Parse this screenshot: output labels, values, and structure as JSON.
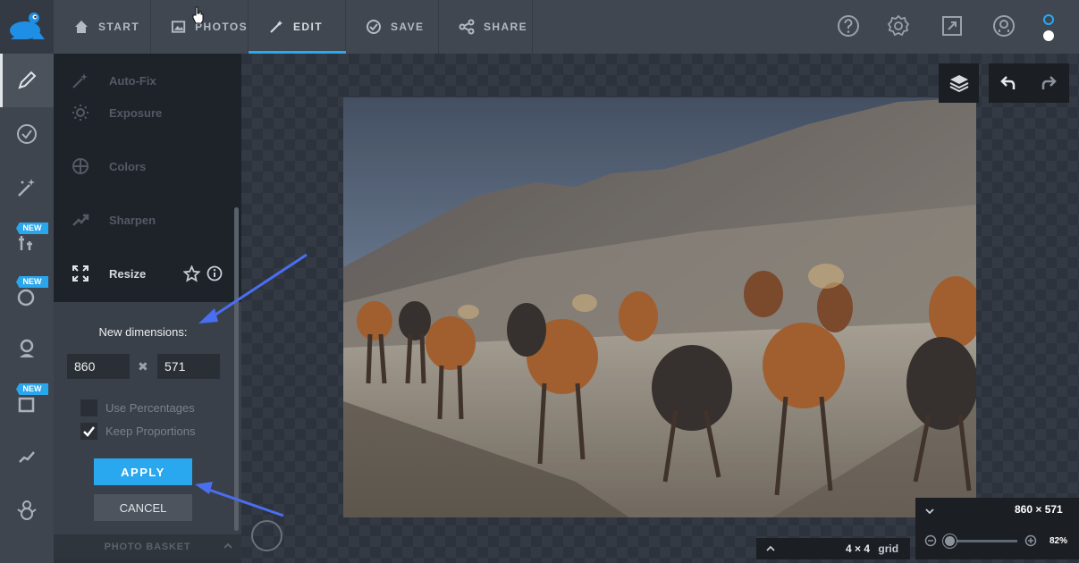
{
  "topbar": {
    "tabs": [
      {
        "label": "START",
        "icon": "home-icon"
      },
      {
        "label": "PHOTOS",
        "icon": "image-icon"
      },
      {
        "label": "EDIT",
        "icon": "magic-wand-icon"
      },
      {
        "label": "SAVE",
        "icon": "check-circle-icon"
      },
      {
        "label": "SHARE",
        "icon": "share-icon"
      }
    ],
    "active_tab": "EDIT",
    "right_icons": [
      "help-icon",
      "settings-badge-icon",
      "fullscreen-icon",
      "account-icon"
    ]
  },
  "sidebar": {
    "items": [
      {
        "icon": "pencil-icon",
        "active": true
      },
      {
        "icon": "gear-badge-icon"
      },
      {
        "icon": "magic-wand-icon"
      },
      {
        "icon": "brush-tools-icon",
        "badge": "NEW"
      },
      {
        "icon": "circle-shape-icon",
        "badge": "NEW"
      },
      {
        "icon": "person-icon"
      },
      {
        "icon": "frame-icon",
        "badge": "NEW"
      },
      {
        "icon": "trend-line-icon"
      },
      {
        "icon": "snowman-icon"
      }
    ]
  },
  "edit_panel": {
    "tools": [
      {
        "label": "Auto-Fix",
        "icon": "magic-wand-icon"
      },
      {
        "label": "Exposure",
        "icon": "sun-icon"
      },
      {
        "label": "Colors",
        "icon": "target-icon"
      },
      {
        "label": "Sharpen",
        "icon": "trend-up-icon"
      },
      {
        "label": "Resize",
        "icon": "resize-icon",
        "active": true
      }
    ],
    "resize": {
      "label": "New dimensions:",
      "width": "860",
      "height": "571",
      "times_symbol": "✖",
      "use_percentages": {
        "label": "Use Percentages",
        "checked": false
      },
      "keep_proportions": {
        "label": "Keep Proportions",
        "checked": true
      },
      "apply_label": "APPLY",
      "cancel_label": "CANCEL"
    },
    "photo_basket_label": "PHOTO BASKET"
  },
  "canvas": {
    "grid_value": "4 × 4",
    "grid_label": "grid",
    "image_size": "860 × 571",
    "zoom": "82%",
    "zoom_level": 0.82
  },
  "colors": {
    "accent": "#28a9f1",
    "annotation_arrow": "#4a6ef0"
  }
}
